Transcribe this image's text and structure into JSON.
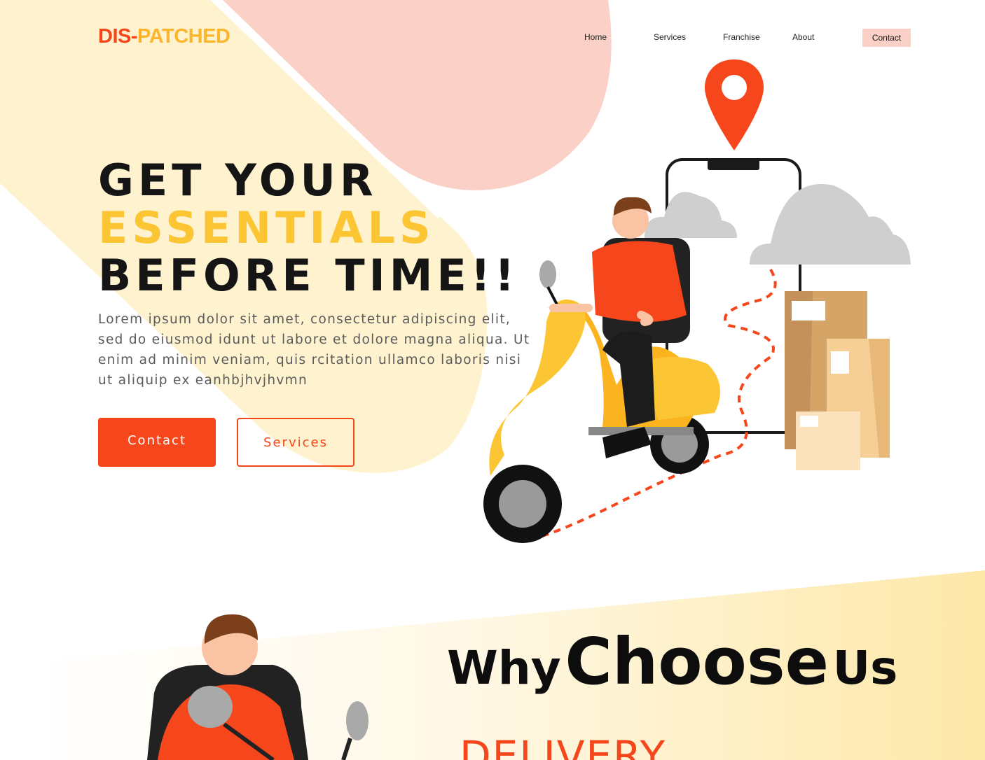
{
  "brand": {
    "part1": "DIS-",
    "part2": "PATCHED"
  },
  "nav": {
    "home": "Home",
    "services": "Services",
    "franchise": "Franchise",
    "about": "About",
    "contact": "Contact"
  },
  "hero": {
    "line1": "GET YOUR",
    "line2": "ESSENTIALS",
    "line3": "BEFORE TIME!!",
    "paragraph": "Lorem ipsum dolor sit amet, consectetur adipiscing elit, sed do eiusmod idunt ut labore et dolore magna aliqua. Ut enim ad minim veniam, quis rcitation ullamco laboris nisi ut aliquip ex eanhbjhvjhvmn",
    "primary_button": "Contact",
    "secondary_button": "Services"
  },
  "why": {
    "word1": "Why",
    "word2": "Choose",
    "word3": "Us",
    "delivery": "DELIVERY"
  },
  "colors": {
    "accent": "#f6461b",
    "brand_yellow": "#fcb62d",
    "hero_yellow": "#fcc534",
    "blob_pink": "#fbd0c6",
    "blob_cream": "#fef2cf"
  },
  "icons": [
    "location-pin-icon",
    "cloud-icon",
    "fragile-icons"
  ]
}
